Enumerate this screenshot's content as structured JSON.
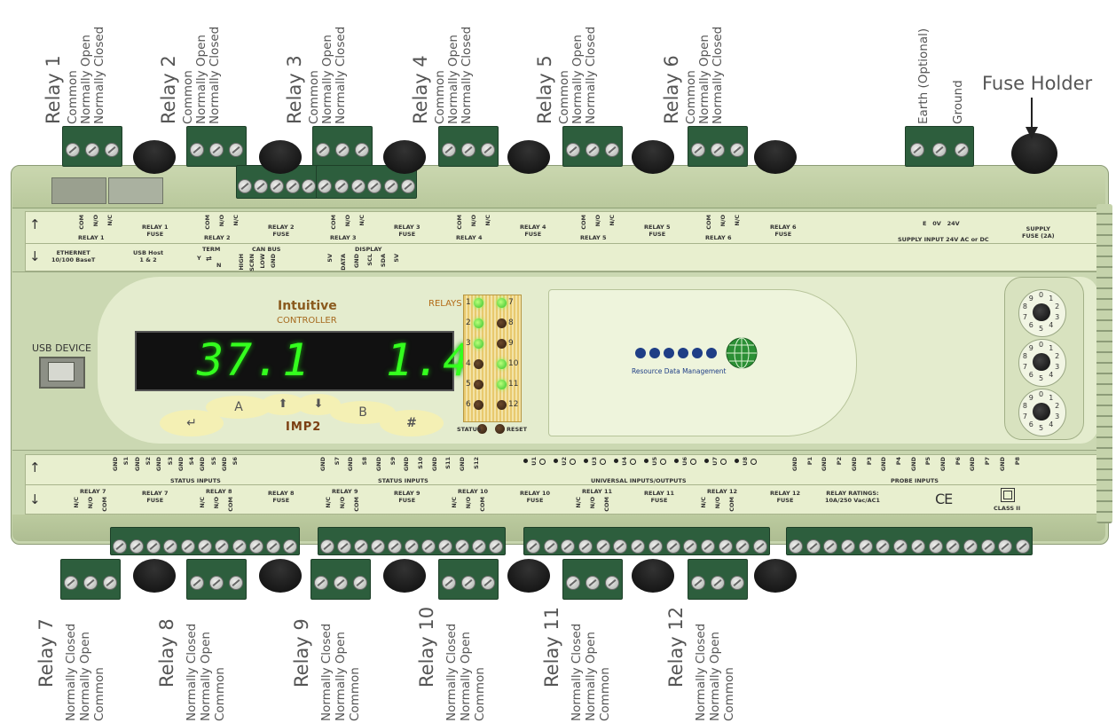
{
  "callouts": {
    "top_relays": [
      {
        "title": "Relay 1",
        "pins": [
          "Common",
          "Normally Open",
          "Normally Closed"
        ]
      },
      {
        "title": "Relay 2",
        "pins": [
          "Common",
          "Normally Open",
          "Normally Closed"
        ]
      },
      {
        "title": "Relay 3",
        "pins": [
          "Common",
          "Normally Open",
          "Normally Closed"
        ]
      },
      {
        "title": "Relay 4",
        "pins": [
          "Common",
          "Normally Open",
          "Normally Closed"
        ]
      },
      {
        "title": "Relay 5",
        "pins": [
          "Common",
          "Normally Open",
          "Normally Closed"
        ]
      },
      {
        "title": "Relay 6",
        "pins": [
          "Common",
          "Normally Open",
          "Normally Closed"
        ]
      }
    ],
    "supply": [
      "Earth (Optional)",
      "Ground"
    ],
    "fuse_holder": "Fuse Holder",
    "bottom_relays": [
      {
        "title": "Relay 7",
        "pins": [
          "Normally Closed",
          "Normally Open",
          "Common"
        ]
      },
      {
        "title": "Relay 8",
        "pins": [
          "Normally Closed",
          "Normally Open",
          "Common"
        ]
      },
      {
        "title": "Relay 9",
        "pins": [
          "Normally Closed",
          "Normally Open",
          "Common"
        ]
      },
      {
        "title": "Relay 10",
        "pins": [
          "Normally Closed",
          "Normally Open",
          "Common"
        ]
      },
      {
        "title": "Relay 11",
        "pins": [
          "Normally Closed",
          "Normally Open",
          "Common"
        ]
      },
      {
        "title": "Relay 12",
        "pins": [
          "Normally Closed",
          "Normally Open",
          "Common"
        ]
      }
    ]
  },
  "top_strip": {
    "pins": [
      "COM",
      "N/O",
      "N/C"
    ],
    "relay_labels": [
      "RELAY 1",
      "RELAY 2",
      "RELAY 3",
      "RELAY 4",
      "RELAY 5",
      "RELAY 6"
    ],
    "fuse_labels": [
      "RELAY 1\nFUSE",
      "RELAY 2\nFUSE",
      "RELAY 3\nFUSE",
      "RELAY 4\nFUSE",
      "RELAY 5\nFUSE",
      "RELAY 6\nFUSE"
    ],
    "supply_pins": "E   0V   24V",
    "supply_input": "SUPPLY INPUT 24V AC or DC",
    "supply_fuse": "SUPPLY\nFUSE (2A)"
  },
  "second_strip": {
    "ethernet": "ETHERNET\n10/100 BaseT",
    "usb_host": "USB Host\n1 & 2",
    "term": "TERM",
    "term_y": "Y",
    "term_n": "N",
    "can_bus": "CAN BUS",
    "can_pins": [
      "HIGH",
      "SCRN",
      "LOW",
      "GND"
    ],
    "display": "DISPLAY",
    "display_pins": [
      "5V",
      "DATA",
      "GND",
      "SCL",
      "SDA",
      "5V"
    ]
  },
  "panel": {
    "usb_device": "USB DEVICE",
    "brand": "Intuitive",
    "brand_sub": "CONTROLLER",
    "display_left": "37.1",
    "display_right": "1.4",
    "keys": [
      "A",
      "B",
      "#"
    ],
    "model": "IMP2",
    "relays_title": "RELAYS",
    "relay_leds": [
      {
        "n": "1",
        "on": true
      },
      {
        "n": "2",
        "on": true
      },
      {
        "n": "3",
        "on": true
      },
      {
        "n": "4",
        "on": false
      },
      {
        "n": "5",
        "on": false
      },
      {
        "n": "6",
        "on": false
      },
      {
        "n": "7",
        "on": true
      },
      {
        "n": "8",
        "on": false
      },
      {
        "n": "9",
        "on": false
      },
      {
        "n": "10",
        "on": true
      },
      {
        "n": "11",
        "on": true
      },
      {
        "n": "12",
        "on": false
      }
    ],
    "status": "STATUS",
    "reset": "RESET",
    "logo_text": "Resource Data Management",
    "dial_digits": "0123456789"
  },
  "bottom_strip": {
    "status_pins": [
      "GND",
      "S1",
      "GND",
      "S2",
      "GND",
      "S3",
      "GND",
      "S4",
      "GND",
      "S5",
      "GND",
      "S6",
      "GND",
      "S7",
      "GND",
      "S8",
      "GND",
      "S9",
      "GND",
      "S10",
      "GND",
      "S11",
      "GND",
      "S12"
    ],
    "status_inputs": "STATUS INPUTS",
    "universal_pins": [
      "U1",
      "U2",
      "U3",
      "U4",
      "U5",
      "U6",
      "U7",
      "U8"
    ],
    "universal_label": "UNIVERSAL INPUTS/OUTPUTS",
    "probe_pins": [
      "GND",
      "P1",
      "GND",
      "P2",
      "GND",
      "P3",
      "GND",
      "P4",
      "GND",
      "P5",
      "GND",
      "P6",
      "GND",
      "P7",
      "GND",
      "P8"
    ],
    "probe_label": "PROBE INPUTS",
    "pins": [
      "N/C",
      "N/O",
      "COM"
    ],
    "relay_labels": [
      "RELAY 7",
      "RELAY 8",
      "RELAY 9",
      "RELAY 10",
      "RELAY 11",
      "RELAY 12"
    ],
    "fuse_labels": [
      "RELAY 7\nFUSE",
      "RELAY 8\nFUSE",
      "RELAY 9\nFUSE",
      "RELAY 10\nFUSE",
      "RELAY 11\nFUSE",
      "RELAY 12\nFUSE"
    ],
    "ratings": "RELAY RATINGS:\n10A/250 Vac/AC1",
    "ce": "CE",
    "class": "CLASS II"
  },
  "colors": {
    "body": "#c9d7b0",
    "terminal": "#2d5e3d",
    "display_green": "#34ff1e",
    "panel": "#e7efd2"
  }
}
